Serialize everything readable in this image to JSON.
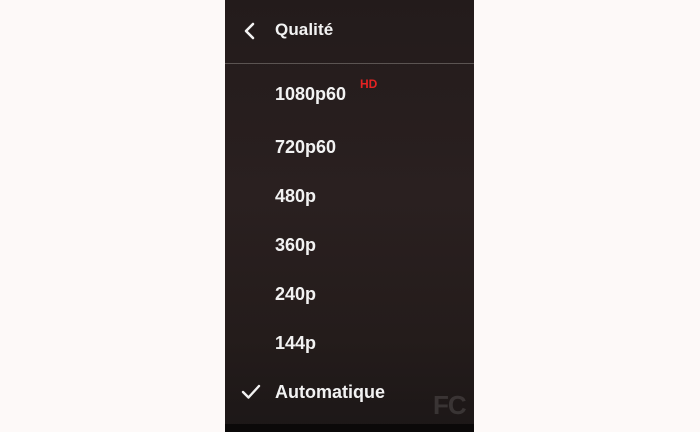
{
  "header": {
    "title": "Qualité",
    "back_icon": "chevron-left-icon"
  },
  "options": [
    {
      "label": "1080p60",
      "badge": "HD",
      "selected": false
    },
    {
      "label": "720p60",
      "selected": false
    },
    {
      "label": "480p",
      "selected": false
    },
    {
      "label": "360p",
      "selected": false
    },
    {
      "label": "240p",
      "selected": false
    },
    {
      "label": "144p",
      "selected": false
    },
    {
      "label": "Automatique",
      "selected": true
    }
  ],
  "watermark": "FC",
  "colors": {
    "menu_background": "#2a2020",
    "text": "#f2f2f2",
    "hd_badge": "#e52222",
    "page_background": "#fdf9f8"
  }
}
